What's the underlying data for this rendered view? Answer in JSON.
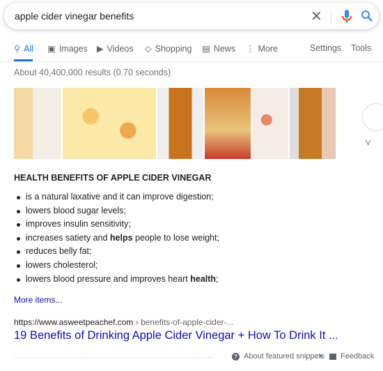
{
  "search": {
    "query": "apple cider vinegar benefits"
  },
  "tabs": [
    {
      "label": "All",
      "icon": "search-icon"
    },
    {
      "label": "Images",
      "icon": "image-icon"
    },
    {
      "label": "Videos",
      "icon": "play-icon"
    },
    {
      "label": "Shopping",
      "icon": "tag-icon"
    },
    {
      "label": "News",
      "icon": "news-icon"
    },
    {
      "label": "More",
      "icon": "more-vert-icon"
    }
  ],
  "tools": {
    "settings": "Settings",
    "tools": "Tools"
  },
  "stats": "About 40,400,000 results (0.70 seconds)",
  "image_strip": {
    "next_label": "V"
  },
  "snippet": {
    "heading": "HEALTH BENEFITS OF APPLE CIDER VINEGAR",
    "items": [
      {
        "pre": "is a natural laxative and it can improve digestion;",
        "bold": "",
        "post": ""
      },
      {
        "pre": "lowers blood sugar levels;",
        "bold": "",
        "post": ""
      },
      {
        "pre": "improves insulin sensitivity;",
        "bold": "",
        "post": ""
      },
      {
        "pre": "increases satiety and ",
        "bold": "helps",
        "post": " people to lose weight;"
      },
      {
        "pre": "reduces belly fat;",
        "bold": "",
        "post": ""
      },
      {
        "pre": "lowers cholesterol;",
        "bold": "",
        "post": ""
      },
      {
        "pre": "lowers blood pressure and improves heart ",
        "bold": "health",
        "post": ";"
      }
    ],
    "more": "More items..."
  },
  "result": {
    "url": "https://www.asweetpeachef.com",
    "breadcrumb": " › benefits-of-apple-cider-...",
    "title": "19 Benefits of Drinking Apple Cider Vinegar + How To Drink It ..."
  },
  "footer": {
    "about": "About featured snippets",
    "dot": "•",
    "feedback": "Feedback"
  },
  "colors": {
    "link": "#1a0dab",
    "accent": "#1a73e8"
  }
}
